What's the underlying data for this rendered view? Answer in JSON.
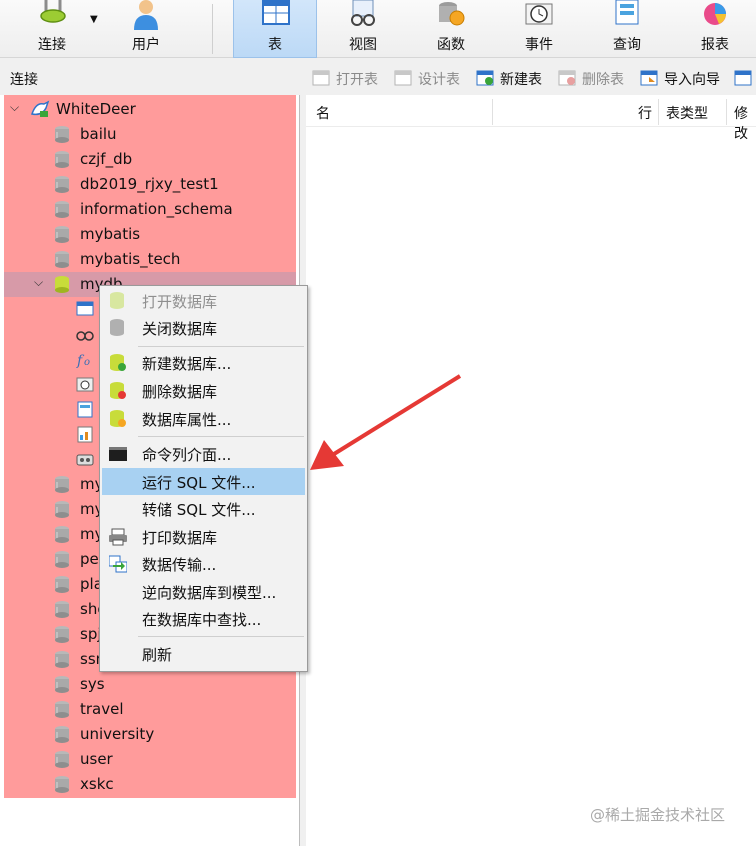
{
  "toolbar": {
    "connect_label": "连接",
    "user_label": "用户",
    "table_label": "表",
    "view_label": "视图",
    "function_label": "函数",
    "event_label": "事件",
    "query_label": "查询",
    "report_label": "报表"
  },
  "connection_header": "连接",
  "object_toolbar": {
    "open_table": "打开表",
    "design_table": "设计表",
    "new_table": "新建表",
    "delete_table": "删除表",
    "import_wizard": "导入向导"
  },
  "object_list": {
    "columns": [
      "名",
      "行",
      "表类型",
      "修改"
    ]
  },
  "tree": {
    "connection_name": "WhiteDeer",
    "databases_before": [
      "bailu",
      "czjf_db",
      "db2019_rjxy_test1",
      "information_schema",
      "mybatis",
      "mybatis_tech"
    ],
    "selected_db": "mydb",
    "databases_partial": [
      "my",
      "my",
      "my",
      "pe",
      "pla",
      "sho",
      "spj",
      "ssm"
    ],
    "databases_after": [
      "sys",
      "travel",
      "university",
      "user",
      "xskc"
    ]
  },
  "context_menu": {
    "items": [
      {
        "label": "打开数据库",
        "disabled": true
      },
      {
        "label": "关闭数据库",
        "disabled": false
      },
      {
        "label": "新建数据库...",
        "disabled": false
      },
      {
        "label": "删除数据库",
        "disabled": false
      },
      {
        "label": "数据库属性...",
        "disabled": false
      },
      {
        "label": "命令列介面...",
        "disabled": false
      },
      {
        "label": "运行 SQL 文件...",
        "disabled": false,
        "hover": true
      },
      {
        "label": "转储 SQL 文件...",
        "disabled": false
      },
      {
        "label": "打印数据库",
        "disabled": false
      },
      {
        "label": "数据传输...",
        "disabled": false
      },
      {
        "label": "逆向数据库到模型...",
        "disabled": false
      },
      {
        "label": "在数据库中查找...",
        "disabled": false
      },
      {
        "label": "刷新",
        "disabled": false
      }
    ]
  },
  "watermark": "@稀土掘金技术社区",
  "colors": {
    "tree_highlight": "#ff9b9b",
    "selected_row": "#d79aa8",
    "menu_hover": "#a8d1f2",
    "arrow": "#e53935",
    "active_tool": "#bcd9f6"
  }
}
